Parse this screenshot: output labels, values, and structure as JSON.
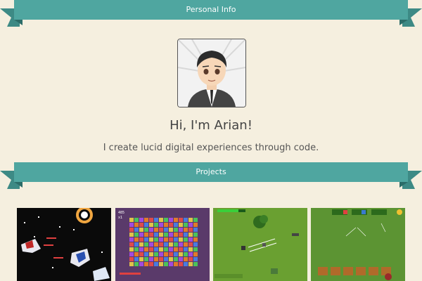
{
  "sections": {
    "personal": "Personal Info",
    "projects": "Projects"
  },
  "profile": {
    "greeting": "Hi, I'm Arian!",
    "tagline": "I create lucid digital experiences through code."
  },
  "projects": [
    {
      "icon": "space-shooter-game-screenshot"
    },
    {
      "icon": "match-blocks-puzzle-game-screenshot",
      "score": "485",
      "multiplier": "x1"
    },
    {
      "icon": "top-down-shooter-game-screenshot"
    },
    {
      "icon": "farm-strategy-game-screenshot"
    }
  ],
  "colors": {
    "background": "#f5efdf",
    "ribbon": "#4fa6a0",
    "ribbon_dark": "#3d8a85"
  }
}
